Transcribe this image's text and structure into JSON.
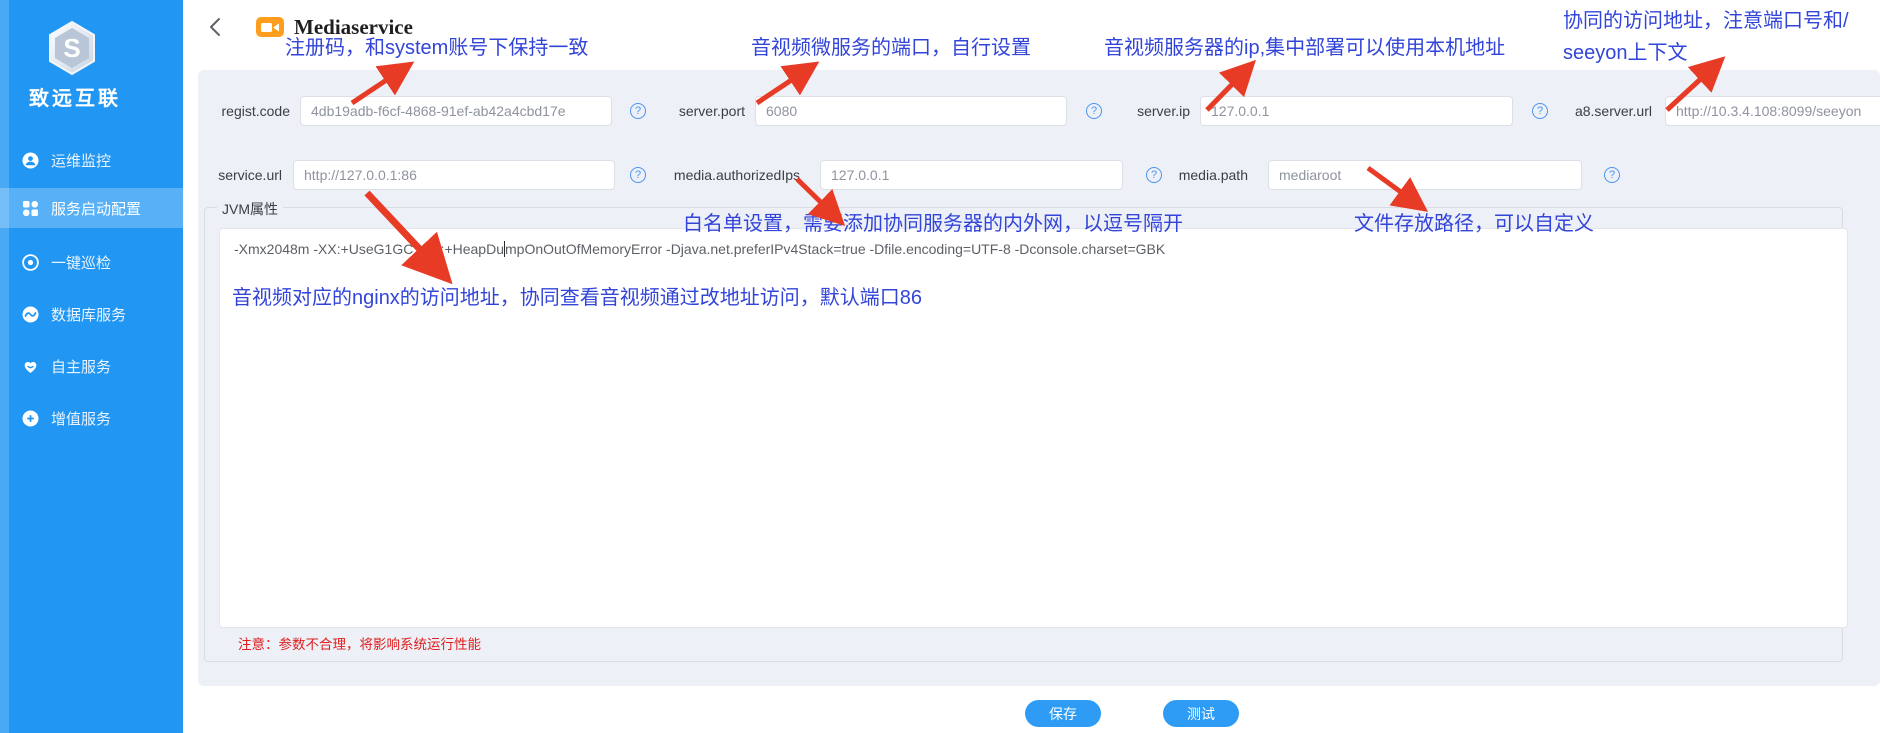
{
  "sidebar": {
    "brand": "致远互联",
    "logo_letter": "S",
    "items": [
      {
        "label": "运维监控",
        "active": false
      },
      {
        "label": "服务启动配置",
        "active": true
      },
      {
        "label": "一键巡检",
        "active": false
      },
      {
        "label": "数据库服务",
        "active": false
      },
      {
        "label": "自主服务",
        "active": false
      },
      {
        "label": "增值服务",
        "active": false
      }
    ]
  },
  "header": {
    "title": "Mediaservice"
  },
  "form": {
    "fields": [
      {
        "label": "regist.code",
        "value": "4db19adb-f6cf-4868-91ef-ab42a4cbd17e"
      },
      {
        "label": "server.port",
        "value": "6080"
      },
      {
        "label": "server.ip",
        "value": "127.0.0.1"
      },
      {
        "label": "a8.server.url",
        "value": "http://10.3.4.108:8099/seeyon"
      },
      {
        "label": "service.url",
        "value": "http://127.0.0.1:86"
      },
      {
        "label": "media.authorizedIps",
        "value": "127.0.0.1"
      },
      {
        "label": "media.path",
        "value": "mediaroot"
      }
    ],
    "help_icon": "?"
  },
  "jvm": {
    "label": "JVM属性",
    "value_before_caret": "-Xmx2048m -XX:+UseG1GC -XX:+HeapDu",
    "value_after_caret": "mpOnOutOfMemoryError -Djava.net.preferIPv4Stack=true -Dfile.encoding=UTF-8 -Dconsole.charset=GBK",
    "warning": "注意：参数不合理，将影响系统运行性能"
  },
  "annotations": {
    "regist_code": "注册码，和system账号下保持一致",
    "server_port": "音视频微服务的端口，自行设置",
    "server_ip": "音视频服务器的ip,集中部署可以使用本机地址",
    "a8_url_line1": "协同的访问地址，注意端口号和/",
    "a8_url_line2": "seeyon上下文",
    "whitelist": "白名单设置，需要添加协同服务器的内外网，以逗号隔开",
    "media_path": "文件存放路径，可以自定义",
    "nginx": "音视频对应的nginx的访问地址，协同查看音视频通过改地址访问，默认端口86"
  },
  "actions": {
    "save": "保存",
    "test": "测试"
  },
  "colors": {
    "sidebar_blue": "#2196f3",
    "annotation_blue": "#3345d9",
    "arrow_red": "#e83b25",
    "button_blue": "#2e9cf5",
    "warning_red": "#e02020",
    "panel_gray": "#edf0f6"
  }
}
